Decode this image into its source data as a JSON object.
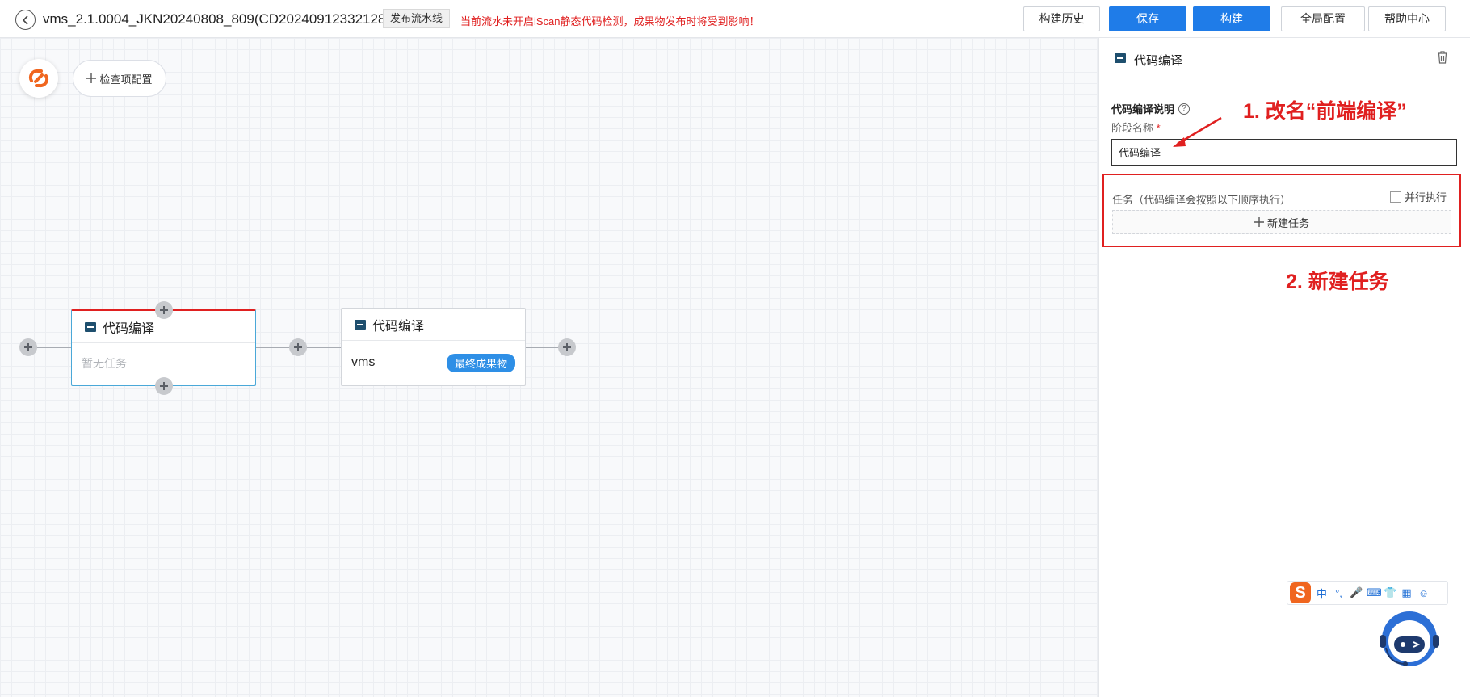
{
  "header": {
    "title": "vms_2.1.0004_JKN20240808_809(CD20240912332128)",
    "publish_btn": "发布流水线",
    "warning": "当前流水未开启iScan静态代码检测，成果物发布时将受到影响！",
    "buttons": {
      "history": "构建历史",
      "save": "保存",
      "build": "构建",
      "global_config": "全局配置",
      "help": "帮助中心"
    }
  },
  "canvas": {
    "check_config_label": "检查项配置",
    "stages": [
      {
        "title": "代码编译",
        "body_text": "暂无任务"
      },
      {
        "title": "代码编译",
        "job": "vms",
        "badge": "最终成果物"
      }
    ]
  },
  "panel": {
    "title": "代码编译",
    "description_label": "代码编译说明",
    "name_label": "阶段名称",
    "required_mark": "*",
    "name_value": "代码编译",
    "tasks_label": "任务（代码编译会按照以下顺序执行）",
    "parallel_label": "并行执行",
    "new_task_label": "新建任务"
  },
  "annotations": {
    "step1": "1. 改名“前端编译”",
    "step2": "2. 新建任务"
  },
  "ime": {
    "logo": "S",
    "items": [
      "中",
      "°,",
      "🎤",
      "⌨",
      "👕",
      "▦",
      "☺"
    ]
  },
  "colors": {
    "primary": "#1f7ce8",
    "warning": "#e02020",
    "badge": "#2e8fe6",
    "logo_orange": "#f0661f"
  }
}
